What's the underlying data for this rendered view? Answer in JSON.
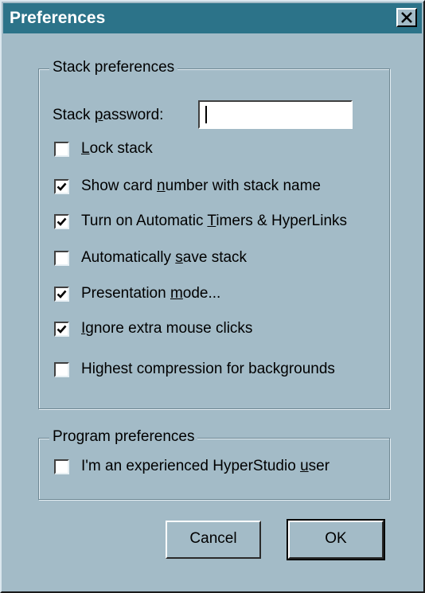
{
  "window": {
    "title": "Preferences",
    "title_bar_color": "#2c7389",
    "background_color": "#a3bbc7"
  },
  "stack_group": {
    "legend": "Stack preferences",
    "password_label_pre": "Stack ",
    "password_label_u": "p",
    "password_label_post": "assword:",
    "password_value": "",
    "checkboxes": [
      {
        "pre": "",
        "u": "L",
        "post": "ock stack",
        "checked": false
      },
      {
        "pre": "Show card ",
        "u": "n",
        "post": "umber with stack name",
        "checked": true
      },
      {
        "pre": "Turn on Automatic ",
        "u": "T",
        "post": "imers & HyperLinks",
        "checked": true
      },
      {
        "pre": "Automatically ",
        "u": "s",
        "post": "ave stack",
        "checked": false
      },
      {
        "pre": "Presentation ",
        "u": "m",
        "post": "ode...",
        "checked": true
      },
      {
        "pre": "",
        "u": "I",
        "post": "gnore extra mouse clicks",
        "checked": true
      },
      {
        "pre": "Highest compression for backgrounds",
        "u": "",
        "post": "",
        "checked": false
      }
    ]
  },
  "program_group": {
    "legend": "Program preferences",
    "checkboxes": [
      {
        "pre": "I'm an experienced HyperStudio ",
        "u": "u",
        "post": "ser",
        "checked": false
      }
    ]
  },
  "buttons": {
    "cancel": "Cancel",
    "ok": "OK"
  },
  "icons": {
    "close": "close-icon",
    "check": "checkmark-icon"
  }
}
